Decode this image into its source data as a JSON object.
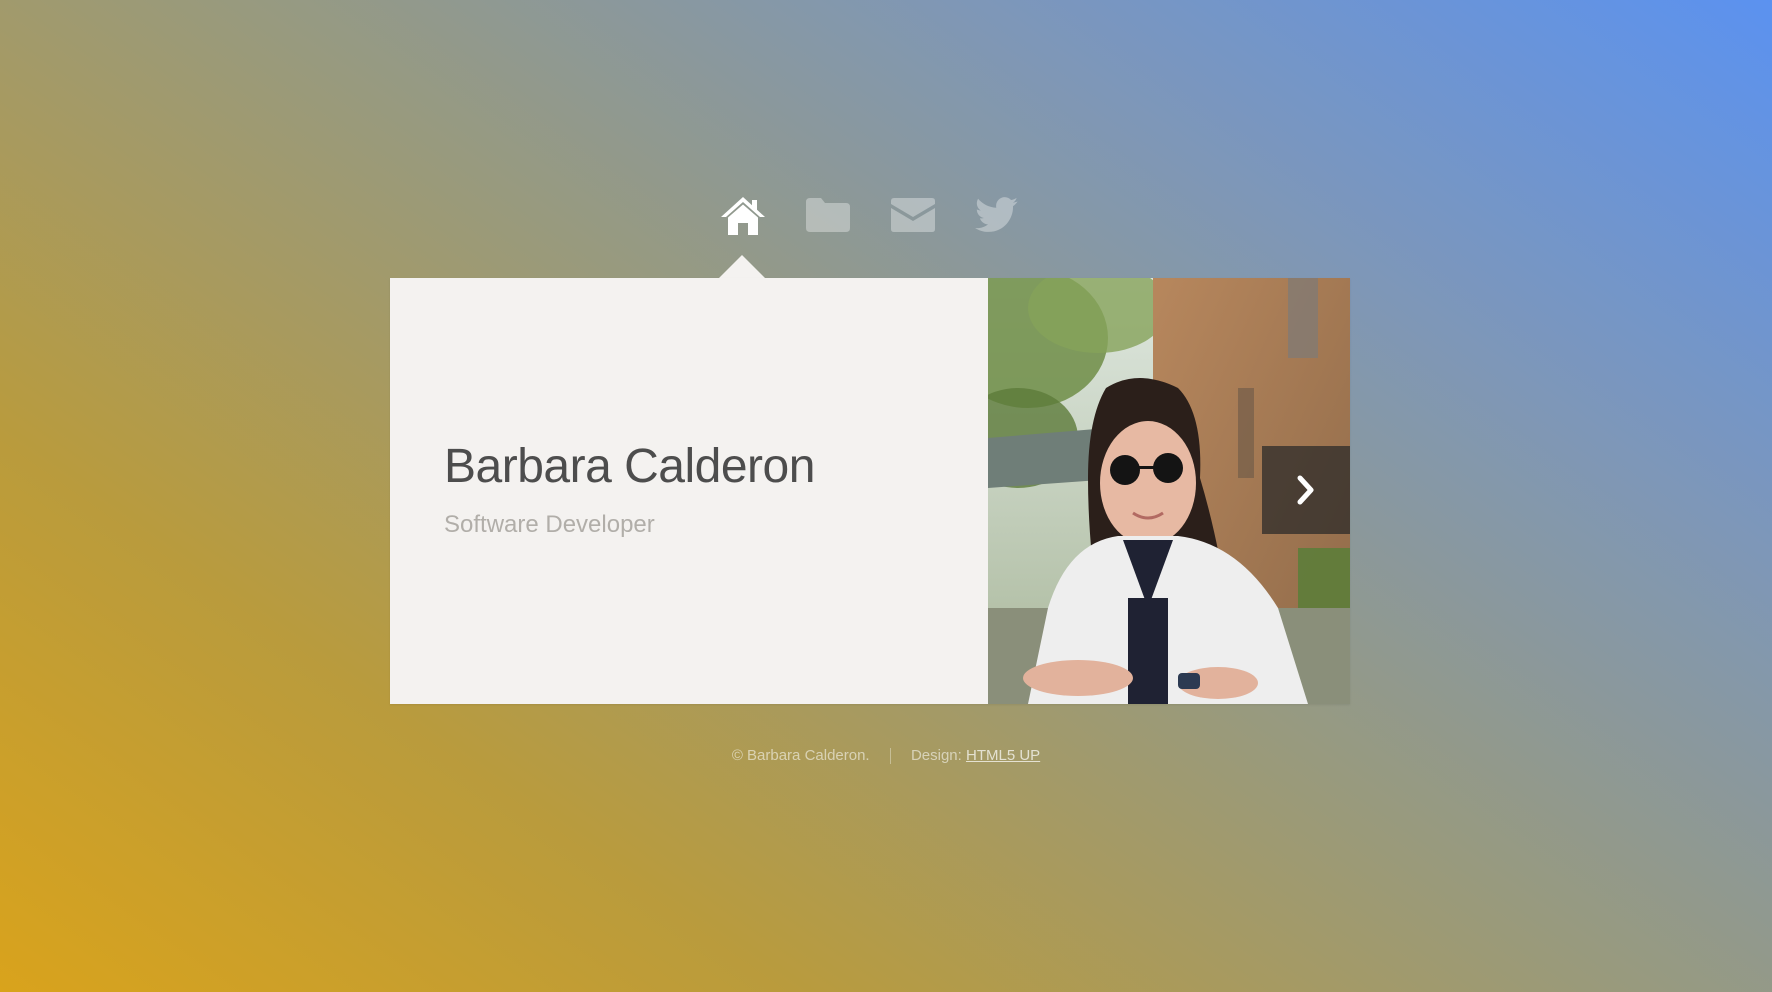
{
  "nav": {
    "items": [
      {
        "icon": "home-icon",
        "active": true
      },
      {
        "icon": "folder-icon",
        "active": false
      },
      {
        "icon": "envelope-icon",
        "active": false
      },
      {
        "icon": "twitter-icon",
        "active": false
      }
    ]
  },
  "intro": {
    "name": "Barbara Calderon",
    "role": "Software Developer"
  },
  "photo": {
    "next_icon": "chevron-right-icon"
  },
  "footer": {
    "copyright": "© Barbara Calderon.",
    "design_label": "Design:",
    "design_link": "HTML5 UP"
  },
  "colors": {
    "panel": "#f4f2f0",
    "name_text": "#4d4d4d",
    "role_text": "#b1aea9",
    "gradient_start": "#d9a31c",
    "gradient_end": "#5b92f0"
  }
}
